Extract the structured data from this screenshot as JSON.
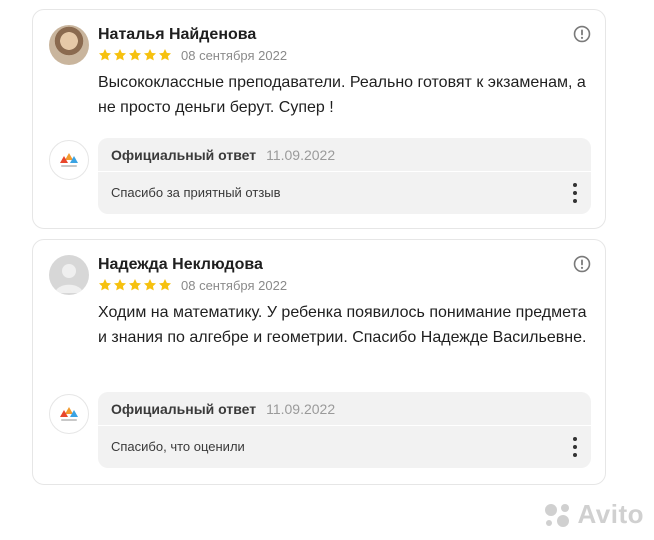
{
  "reviews": [
    {
      "author": "Наталья Найденова",
      "rating": 5,
      "date": "08 сентября 2022",
      "text": "Высококлассные преподаватели. Реально готовят к экзаменам, а не просто деньги берут. Супер !",
      "reply": {
        "title": "Официальный ответ",
        "date": "11.09.2022",
        "text": "Спасибо за приятный отзыв"
      }
    },
    {
      "author": "Надежда Неклюдова",
      "rating": 5,
      "date": "08 сентября 2022",
      "text": "Ходим на математику. У ребенка появилось понимание предмета и знания по алгебре и геометрии. Спасибо Надежде Васильевне.",
      "reply": {
        "title": "Официальный ответ",
        "date": "11.09.2022",
        "text": "Спасибо, что оценили"
      }
    }
  ],
  "watermark": "Avito",
  "colors": {
    "star": "#f6c10f",
    "card_border": "#e6e6e6",
    "reply_bg": "#f2f2f2"
  },
  "icons": {
    "report": "info-circle-icon",
    "more": "more-vertical-icon",
    "star": "star-icon",
    "org_logo": "org-logo-icon"
  }
}
